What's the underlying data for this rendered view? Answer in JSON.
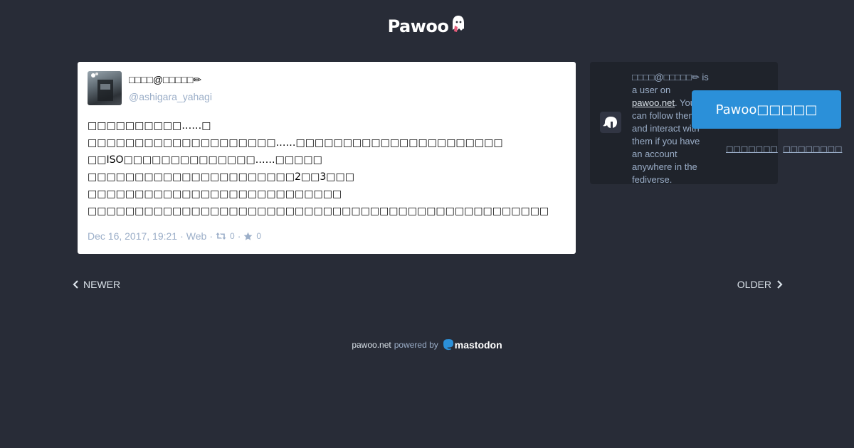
{
  "header": {
    "logo_text": "Pawoo"
  },
  "status": {
    "display_name": "□□□□@□□□□□✏",
    "acct": "@ashigara_yahagi",
    "content_lines": [
      "□□□□□□□□□□……□",
      "□□□□□□□□□□□□□□□□□□□□……□□□□□□□□□□□□□□□□□□□□□□",
      "□□ISO□□□□□□□□□□□□□□……□□□□□",
      "□□□□□□□□□□□□□□□□□□□□□□2□□3□□□",
      "□□□□□□□□□□□□□□□□□□□□□□□□□□□",
      "□□□□□□□□□□□□□□□□□□□□□□□□□□□□□□□□□□□□□□□□□□□□□□□□□"
    ],
    "timestamp": "Dec 16, 2017, 19:21",
    "application": "Web",
    "reblogs_count": "0",
    "favourites_count": "0"
  },
  "sidebar": {
    "account_name": "□□□□@□□□□□✏",
    "text_is_a_user_on": " is a user on ",
    "domain_link": "pawoo.net",
    "text_follow": ". You can follow them and interact with them if you have an account anywhere in the fediverse.",
    "follow_button_label": "Pawoo□□□□□",
    "link_1": "□□□□□□□",
    "link_2": "□□□□□□□□"
  },
  "pagination": {
    "newer_label": "Newer",
    "older_label": "Older"
  },
  "footer": {
    "domain": "pawoo.net",
    "powered_by": "powered by",
    "brand": "mastodon"
  },
  "colors": {
    "background": "#282c37",
    "accent": "#2b90d9",
    "muted": "#9baec8"
  }
}
